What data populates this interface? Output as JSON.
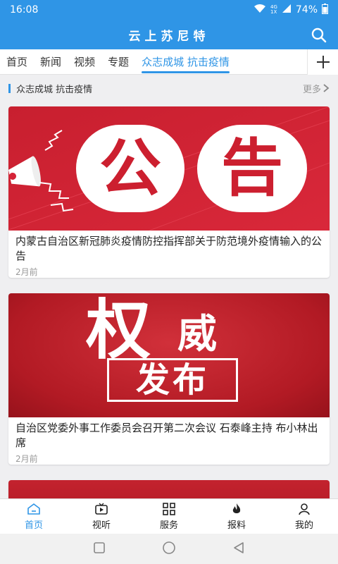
{
  "status": {
    "time": "16:08",
    "network_label": "4G",
    "network_sub": "1X",
    "battery": "74%",
    "icons": [
      "wifi-icon",
      "signal-icon",
      "battery-icon"
    ]
  },
  "app": {
    "title": "云上苏尼特"
  },
  "tabs": [
    {
      "label": "首页"
    },
    {
      "label": "新闻"
    },
    {
      "label": "视频"
    },
    {
      "label": "专题"
    },
    {
      "label": "众志成城 抗击疫情",
      "active": true
    }
  ],
  "section": {
    "title": "众志成城 抗击疫情",
    "more": "更多"
  },
  "articles": [
    {
      "image_text": [
        "公",
        "告"
      ],
      "title": "内蒙古自治区新冠肺炎疫情防控指挥部关于防范境外疫情输入的公告",
      "time": "2月前"
    },
    {
      "image_text": [
        "权",
        "威",
        "发布"
      ],
      "title": "自治区党委外事工作委员会召开第二次会议 石泰峰主持 布小林出席",
      "time": "2月前"
    }
  ],
  "bottom_nav": [
    {
      "label": "首页",
      "icon": "home-icon",
      "active": true
    },
    {
      "label": "视听",
      "icon": "tv-icon"
    },
    {
      "label": "服务",
      "icon": "grid-icon"
    },
    {
      "label": "报料",
      "icon": "fire-icon"
    },
    {
      "label": "我的",
      "icon": "user-icon"
    }
  ],
  "colors": {
    "primary": "#2f95e6",
    "poster_red": "#d6233a",
    "poster_dark_red": "#b5171f"
  }
}
